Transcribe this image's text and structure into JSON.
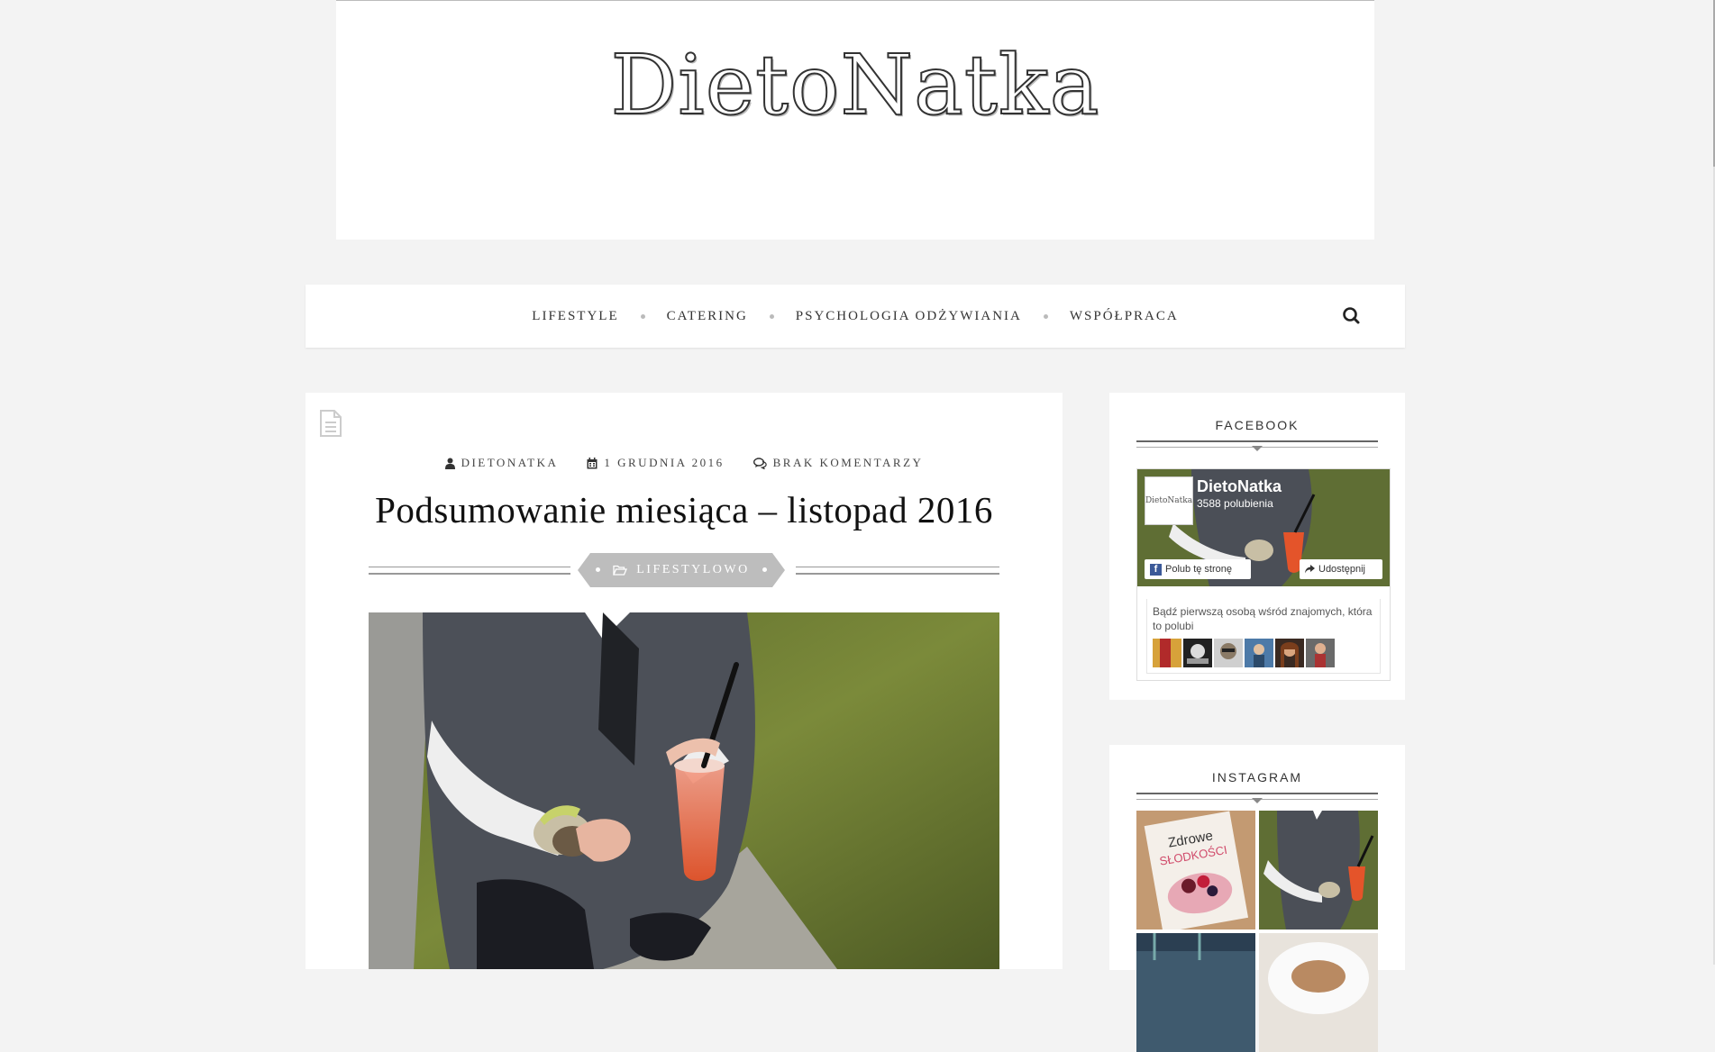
{
  "site": {
    "logo": "DietoNatka"
  },
  "nav": {
    "items": [
      {
        "label": "LIFESTYLE"
      },
      {
        "label": "CATERING"
      },
      {
        "label": "PSYCHOLOGIA ODŻYWIANIA"
      },
      {
        "label": "WSPÓŁPRACA"
      }
    ],
    "search_icon": "search-icon"
  },
  "post": {
    "author": "DIETONATKA",
    "date": "1 GRUDNIA 2016",
    "comments": "BRAK KOMENTARZY",
    "title": "Podsumowanie miesiąca – listopad 2016",
    "category": "LIFESTYLOWO"
  },
  "sidebar": {
    "facebook": {
      "title": "FACEBOOK",
      "page_name": "DietoNatka",
      "thumb_text": "DietoNatka",
      "likes": "3588 polubienia",
      "like_button": "Polub tę stronę",
      "share_button": "Udostępnij",
      "friends_text": "Bądź pierwszą osobą wśród znajomych, która to polubi"
    },
    "instagram": {
      "title": "INSTAGRAM",
      "tile_1_text_top": "Zdrowe",
      "tile_1_text_bottom": "SŁODKOŚCI"
    }
  },
  "colors": {
    "background": "#f3f3f3",
    "badge": "#bdbdbd",
    "facebook_blue": "#3b5998"
  }
}
